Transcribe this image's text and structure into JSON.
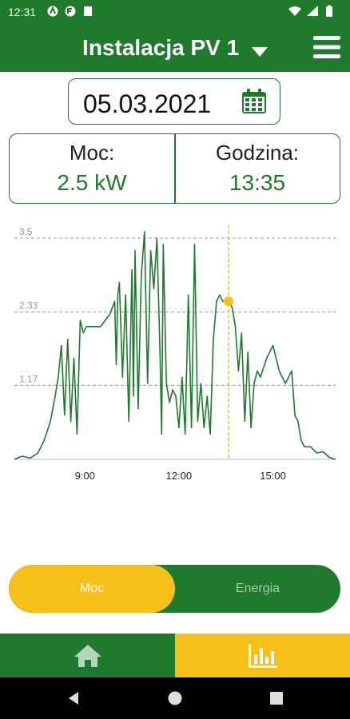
{
  "status_bar": {
    "time": "12:31"
  },
  "app_bar": {
    "title": "Instalacja PV 1"
  },
  "date": "05.03.2021",
  "info": {
    "power_label": "Moc:",
    "power_value": "2.5 kW",
    "hour_label": "Godzina:",
    "hour_value": "13:35"
  },
  "chart_data": {
    "type": "line",
    "y_ticks": [
      "3.5",
      "2.33",
      "1.17"
    ],
    "x_ticks": [
      "9:00",
      "12:00",
      "15:00"
    ],
    "xlim": [
      6.75,
      17.0
    ],
    "ylim": [
      0,
      3.5
    ],
    "selected": {
      "x": 13.583,
      "y": 2.5
    },
    "series": [
      {
        "x": [
          6.75,
          7.0,
          7.25,
          7.5,
          7.7,
          7.9,
          8.05,
          8.15,
          8.25,
          8.35,
          8.45,
          8.55,
          8.65,
          8.75,
          8.85,
          8.95,
          9.05,
          9.2,
          9.5,
          9.8,
          9.95,
          10.0,
          10.05,
          10.1,
          10.2,
          10.3,
          10.4,
          10.5,
          10.55,
          10.6,
          10.7,
          10.8,
          10.9,
          11.0,
          11.1,
          11.2,
          11.3,
          11.4,
          11.45,
          11.5,
          11.6,
          11.7,
          11.8,
          11.9,
          12.0,
          12.1,
          12.2,
          12.3,
          12.4,
          12.5,
          12.6,
          12.7,
          12.8,
          12.9,
          13.0,
          13.1,
          13.2,
          13.3,
          13.4,
          13.5,
          13.583,
          13.7,
          13.8,
          13.9,
          14.0,
          14.1,
          14.2,
          14.3,
          14.4,
          14.5,
          14.6,
          14.8,
          15.0,
          15.2,
          15.4,
          15.6,
          15.7,
          15.8,
          15.9,
          16.0,
          16.2,
          16.4,
          16.6,
          16.8,
          17.0
        ],
        "y": [
          0.0,
          0.05,
          0.02,
          0.1,
          0.3,
          0.6,
          1.0,
          1.3,
          1.8,
          0.7,
          1.9,
          0.6,
          1.6,
          0.4,
          2.2,
          2.0,
          2.1,
          2.1,
          2.1,
          2.3,
          2.5,
          1.5,
          2.6,
          2.8,
          1.3,
          2.6,
          0.6,
          3.0,
          1.0,
          3.3,
          0.8,
          2.9,
          3.6,
          1.2,
          3.3,
          2.7,
          3.5,
          1.6,
          0.4,
          3.4,
          1.2,
          0.9,
          1.1,
          1.0,
          0.5,
          1.3,
          0.4,
          2.6,
          0.5,
          3.4,
          0.6,
          1.2,
          0.5,
          1.0,
          0.4,
          1.9,
          2.5,
          2.6,
          2.5,
          2.5,
          2.5,
          2.4,
          2.1,
          1.4,
          2.0,
          0.6,
          1.7,
          0.5,
          1.2,
          1.4,
          1.3,
          1.6,
          1.8,
          1.4,
          1.2,
          1.4,
          0.7,
          0.6,
          0.3,
          0.2,
          0.2,
          0.1,
          0.12,
          0.03,
          0.0
        ]
      }
    ]
  },
  "toggle": {
    "active": "Moc",
    "inactive": "Energia"
  },
  "colors": {
    "green": "#1f7a2e",
    "yellow": "#f5c019"
  }
}
